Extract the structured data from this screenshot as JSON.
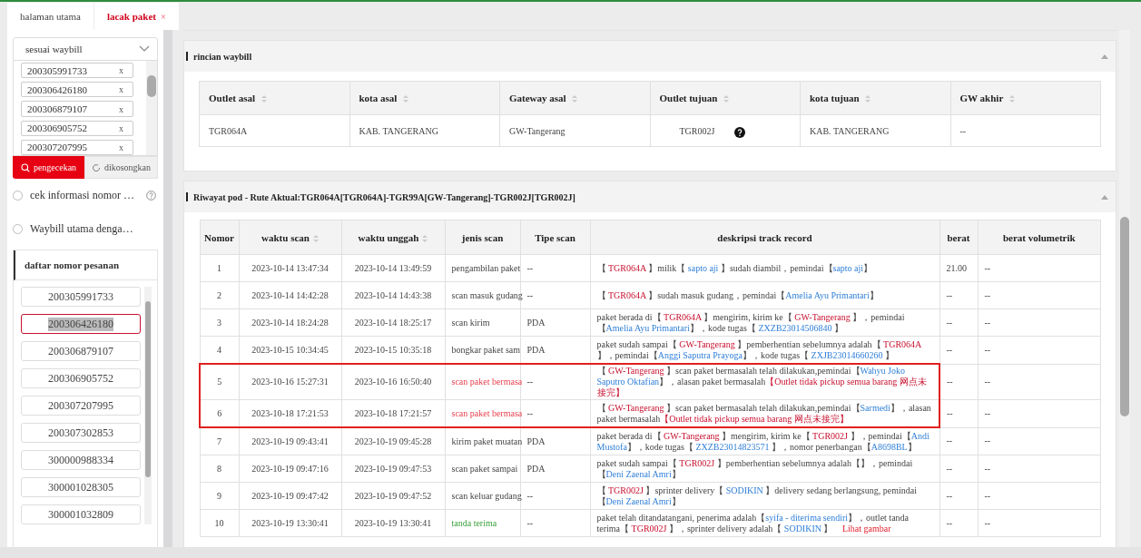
{
  "tabs": [
    {
      "label": "halaman utama",
      "selected": false,
      "closable": false
    },
    {
      "label": "lacak paket",
      "selected": true,
      "closable": true,
      "close": "×"
    }
  ],
  "sidebar": {
    "search_mode": "sesuai waybill",
    "tags": [
      {
        "value": "200305991733",
        "remove": "x"
      },
      {
        "value": "200306426180",
        "remove": "x"
      },
      {
        "value": "200306879107",
        "remove": "x"
      },
      {
        "value": "200306905752",
        "remove": "x"
      },
      {
        "value": "200307207995",
        "remove": "x"
      }
    ],
    "buttons": [
      {
        "label": "pengecekan",
        "kind": "primary"
      },
      {
        "label": "dikosongkan",
        "kind": "reset"
      }
    ],
    "options": [
      {
        "label": "cek informasi nomor …",
        "checked": false,
        "help": true
      },
      {
        "label": "Waybill utama denga…",
        "checked": false,
        "help": false
      }
    ],
    "list_title": "daftar nomor pesanan",
    "list": [
      {
        "label": "200305991733",
        "selected": false
      },
      {
        "label": "200306426180",
        "selected": true
      },
      {
        "label": "200306879107",
        "selected": false
      },
      {
        "label": "200306905752",
        "selected": false
      },
      {
        "label": "200307207995",
        "selected": false
      },
      {
        "label": "200307302853",
        "selected": false
      },
      {
        "label": "300000988334",
        "selected": false
      },
      {
        "label": "300001028305",
        "selected": false
      },
      {
        "label": "300001032809",
        "selected": false
      }
    ]
  },
  "waybill": {
    "title": "rincian waybill",
    "columns": [
      "Outlet asal",
      "kota asal",
      "Gateway asal",
      "Outlet tujuan",
      "kota tujuan",
      "GW akhir"
    ],
    "row": [
      "TGR064A",
      "KAB. TANGERANG",
      "GW-Tangerang",
      "TGR002J",
      "KAB. TANGERANG",
      "--"
    ]
  },
  "history": {
    "title": "Riwayat pod - Rute Aktual:TGR064A[TGR064A]-TGR99A[GW-Tangerang]-TGR002J[TGR002J]",
    "columns": [
      {
        "label": "Nomor",
        "sortable": false
      },
      {
        "label": "waktu scan",
        "sortable": true
      },
      {
        "label": "waktu unggah",
        "sortable": true
      },
      {
        "label": "jenis scan",
        "sortable": false
      },
      {
        "label": "Tipe scan",
        "sortable": false
      },
      {
        "label": "deskripsi track record",
        "sortable": false
      },
      {
        "label": "berat",
        "sortable": false
      },
      {
        "label": "berat volumetrik",
        "sortable": false
      }
    ],
    "rows": [
      {
        "no": "1",
        "scan": "2023-10-14 13:47:34",
        "upload": "2023-10-14 13:49:59",
        "type": "pengambilan paket",
        "kind": "normal",
        "tipe": "--",
        "marked": false,
        "weight": "21.00",
        "volume": "--",
        "desc": [
          {
            "kind": "plain",
            "text": "【 "
          },
          {
            "kind": "red",
            "text": "TGR064A"
          },
          {
            "kind": "plain",
            "text": " 】milik【 "
          },
          {
            "kind": "blue",
            "text": "sapto aji"
          },
          {
            "kind": "plain",
            "text": " 】sudah diambil，pemindai【"
          },
          {
            "kind": "blue",
            "text": "sapto aji"
          },
          {
            "kind": "plain",
            "text": "】"
          }
        ]
      },
      {
        "no": "2",
        "scan": "2023-10-14 14:42:28",
        "upload": "2023-10-14 14:43:38",
        "type": "scan masuk gudang",
        "kind": "normal",
        "tipe": "--",
        "marked": false,
        "weight": "--",
        "volume": "--",
        "desc": [
          {
            "kind": "plain",
            "text": "【 "
          },
          {
            "kind": "red",
            "text": "TGR064A"
          },
          {
            "kind": "plain",
            "text": " 】sudah masuk gudang，pemindai【"
          },
          {
            "kind": "blue",
            "text": "Amelia Ayu Primantari"
          },
          {
            "kind": "plain",
            "text": "】"
          }
        ]
      },
      {
        "no": "3",
        "scan": "2023-10-14 18:24:28",
        "upload": "2023-10-14 18:25:17",
        "type": "scan kirim",
        "kind": "normal",
        "tipe": "PDA",
        "marked": false,
        "weight": "--",
        "volume": "--",
        "desc": [
          {
            "kind": "plain",
            "text": "paket berada di【 "
          },
          {
            "kind": "red",
            "text": "TGR064A"
          },
          {
            "kind": "plain",
            "text": " 】mengirim, kirim ke【 "
          },
          {
            "kind": "red",
            "text": "GW-Tangerang"
          },
          {
            "kind": "plain",
            "text": " 】，pemindai【"
          },
          {
            "kind": "blue",
            "text": "Amelia Ayu Primantari"
          },
          {
            "kind": "plain",
            "text": "】，kode tugas【 "
          },
          {
            "kind": "blue",
            "text": "ZXZB23014506840"
          },
          {
            "kind": "plain",
            "text": " 】"
          }
        ]
      },
      {
        "no": "4",
        "scan": "2023-10-15 10:34:45",
        "upload": "2023-10-15 10:35:18",
        "type": "bongkar paket sam",
        "kind": "normal",
        "tipe": "PDA",
        "marked": false,
        "weight": "--",
        "volume": "--",
        "desc": [
          {
            "kind": "plain",
            "text": "paket sudah sampai【 "
          },
          {
            "kind": "red",
            "text": "GW-Tangerang"
          },
          {
            "kind": "plain",
            "text": " 】pemberhentian sebelumnya adalah【 "
          },
          {
            "kind": "red",
            "text": "TGR064A"
          },
          {
            "kind": "plain",
            "text": " 】，pemindai【"
          },
          {
            "kind": "blue",
            "text": "Anggi Saputra Prayoga"
          },
          {
            "kind": "plain",
            "text": "】，kode tugas【 "
          },
          {
            "kind": "blue",
            "text": "ZXJB23014660260"
          },
          {
            "kind": "plain",
            "text": " 】"
          }
        ]
      },
      {
        "no": "5",
        "scan": "2023-10-16 15:27:31",
        "upload": "2023-10-16 16:50:40",
        "type": "scan paket bermasa",
        "kind": "problem",
        "tipe": "--",
        "marked": true,
        "weight": "--",
        "volume": "--",
        "desc": [
          {
            "kind": "plain",
            "text": "【 "
          },
          {
            "kind": "red",
            "text": "GW-Tangerang"
          },
          {
            "kind": "plain",
            "text": " 】scan paket bermasalah telah dilakukan,pemindai【"
          },
          {
            "kind": "blue",
            "text": "Wahyu Joko Saputro Oktafian"
          },
          {
            "kind": "plain",
            "text": "】，alasan paket bermasalah"
          },
          {
            "kind": "red",
            "text": "【Outlet tidak pickup semua barang 网点未接完】"
          }
        ]
      },
      {
        "no": "6",
        "scan": "2023-10-18 17:21:53",
        "upload": "2023-10-18 17:21:57",
        "type": "scan paket bermasa",
        "kind": "problem",
        "tipe": "--",
        "marked": true,
        "weight": "--",
        "volume": "--",
        "desc": [
          {
            "kind": "plain",
            "text": "【 "
          },
          {
            "kind": "red",
            "text": "GW-Tangerang"
          },
          {
            "kind": "plain",
            "text": " 】scan paket bermasalah telah dilakukan,pemindai【"
          },
          {
            "kind": "blue",
            "text": "Sarmedi"
          },
          {
            "kind": "plain",
            "text": "】，alasan paket bermasalah"
          },
          {
            "kind": "red",
            "text": "【Outlet tidak pickup semua barang 网点未接完】"
          }
        ]
      },
      {
        "no": "7",
        "scan": "2023-10-19 09:43:41",
        "upload": "2023-10-19 09:45:28",
        "type": "kirim paket muatan",
        "kind": "normal",
        "tipe": "PDA",
        "marked": false,
        "weight": "--",
        "volume": "--",
        "desc": [
          {
            "kind": "plain",
            "text": "paket berada di【 "
          },
          {
            "kind": "red",
            "text": "GW-Tangerang"
          },
          {
            "kind": "plain",
            "text": " 】mengirim, kirim ke【 "
          },
          {
            "kind": "red",
            "text": "TGR002J"
          },
          {
            "kind": "plain",
            "text": " 】，pemindai【"
          },
          {
            "kind": "blue",
            "text": "Andi Mustofa"
          },
          {
            "kind": "plain",
            "text": "】，kode tugas【 "
          },
          {
            "kind": "blue",
            "text": "ZXZB23014823571"
          },
          {
            "kind": "plain",
            "text": " 】，nomor penerbangan【"
          },
          {
            "kind": "blue",
            "text": "A8698BL"
          },
          {
            "kind": "plain",
            "text": "】"
          }
        ]
      },
      {
        "no": "8",
        "scan": "2023-10-19 09:47:16",
        "upload": "2023-10-19 09:47:53",
        "type": "scan paket sampai",
        "kind": "normal",
        "tipe": "PDA",
        "marked": false,
        "weight": "--",
        "volume": "--",
        "desc": [
          {
            "kind": "plain",
            "text": "paket sudah sampai【 "
          },
          {
            "kind": "red",
            "text": "TGR002J"
          },
          {
            "kind": "plain",
            "text": " 】pemberhentian sebelumnya adalah【】，pemindai【"
          },
          {
            "kind": "blue",
            "text": "Deni Zaenal Amri"
          },
          {
            "kind": "plain",
            "text": "】"
          }
        ]
      },
      {
        "no": "9",
        "scan": "2023-10-19 09:47:42",
        "upload": "2023-10-19 09:47:52",
        "type": "scan keluar gudang",
        "kind": "normal",
        "tipe": "--",
        "marked": false,
        "weight": "--",
        "volume": "--",
        "desc": [
          {
            "kind": "plain",
            "text": "【 "
          },
          {
            "kind": "red",
            "text": "TGR002J"
          },
          {
            "kind": "plain",
            "text": " 】sprinter delivery【 "
          },
          {
            "kind": "blue",
            "text": "SODIKIN"
          },
          {
            "kind": "plain",
            "text": " 】delivery sedang berlangsung, pemindai【"
          },
          {
            "kind": "blue",
            "text": "Deni Zaenal Amri"
          },
          {
            "kind": "plain",
            "text": "】"
          }
        ]
      },
      {
        "no": "10",
        "scan": "2023-10-19 13:30:41",
        "upload": "2023-10-19 13:30:41",
        "type": "tanda terima",
        "kind": "signed",
        "tipe": "--",
        "marked": false,
        "weight": "--",
        "volume": "--",
        "desc": [
          {
            "kind": "plain",
            "text": "paket telah ditandatangani, penerima adalah【"
          },
          {
            "kind": "blue",
            "text": "syifa - diterima sendiri"
          },
          {
            "kind": "plain",
            "text": "】，outlet tanda terima【 "
          },
          {
            "kind": "red",
            "text": "TGR002J"
          },
          {
            "kind": "plain",
            "text": " 】，sprinter delivery adalah【 "
          },
          {
            "kind": "blue",
            "text": "SODIKIN"
          },
          {
            "kind": "plain",
            "text": " 】 "
          },
          {
            "kind": "link",
            "text": "Lihat gambar"
          }
        ]
      }
    ]
  }
}
